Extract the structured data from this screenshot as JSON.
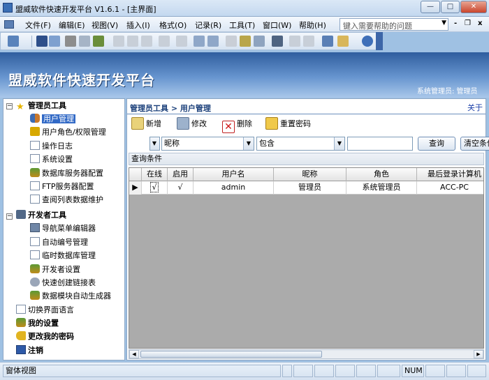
{
  "window": {
    "title": "盟威软件快速开发平台 V1.6.1 - [主界面]",
    "minimize_glyph": "—",
    "maximize_glyph": "□",
    "close_glyph": "✕"
  },
  "menu": {
    "items": [
      "文件(F)",
      "编辑(E)",
      "视图(V)",
      "插入(I)",
      "格式(O)",
      "记录(R)",
      "工具(T)",
      "窗口(W)",
      "帮助(H)"
    ],
    "help_placeholder": "键入需要帮助的问题",
    "mdi_min": "-",
    "mdi_restore": "❐",
    "mdi_close": "x"
  },
  "banner": {
    "title": "盟威软件快速开发平台",
    "user_info": "系统管理员: 管理员"
  },
  "nav": {
    "groups": [
      {
        "label": "管理员工具",
        "expander": "−",
        "items": [
          "用户管理",
          "用户角色/权限管理",
          "操作日志",
          "系统设置",
          "数据库服务器配置",
          "FTP服务器配置",
          "查阅列表数据维护"
        ]
      },
      {
        "label": "开发者工具",
        "expander": "−",
        "items": [
          "导航菜单编辑器",
          "自动编号管理",
          "临时数据库管理",
          "开发者设置",
          "快速创建链接表",
          "数据模块自动生成器"
        ]
      }
    ],
    "top_items": [
      "切换界面语言",
      "我的设置",
      "更改我的密码",
      "注销"
    ],
    "selected": "用户管理"
  },
  "content": {
    "breadcrumb": "管理员工具 > 用户管理",
    "about": "关于",
    "actions": {
      "new": "新增",
      "edit": "修改",
      "delete": "删除",
      "reset_password": "重置密码"
    },
    "filter": {
      "field_prefix": "",
      "field": "昵称",
      "operator": "包含",
      "value": "",
      "query_button": "查询",
      "clear_button": "清空条件"
    },
    "query_conditions_label": "查询条件",
    "table": {
      "columns": [
        "在线",
        "启用",
        "用户名",
        "昵称",
        "角色",
        "最后登录计算机"
      ],
      "rows": [
        {
          "indicator": "▶",
          "online": "√",
          "enabled": "√",
          "username": "admin",
          "nickname": "管理员",
          "role": "系统管理员",
          "last_computer": "ACC-PC"
        }
      ]
    }
  },
  "status": {
    "view": "窗体视图",
    "num": "NUM"
  },
  "colors": {
    "banner_top": "#2f5d9e",
    "banner_bottom": "#a9c7ea",
    "selection": "#3169c6",
    "grid_background": "#ababab"
  }
}
